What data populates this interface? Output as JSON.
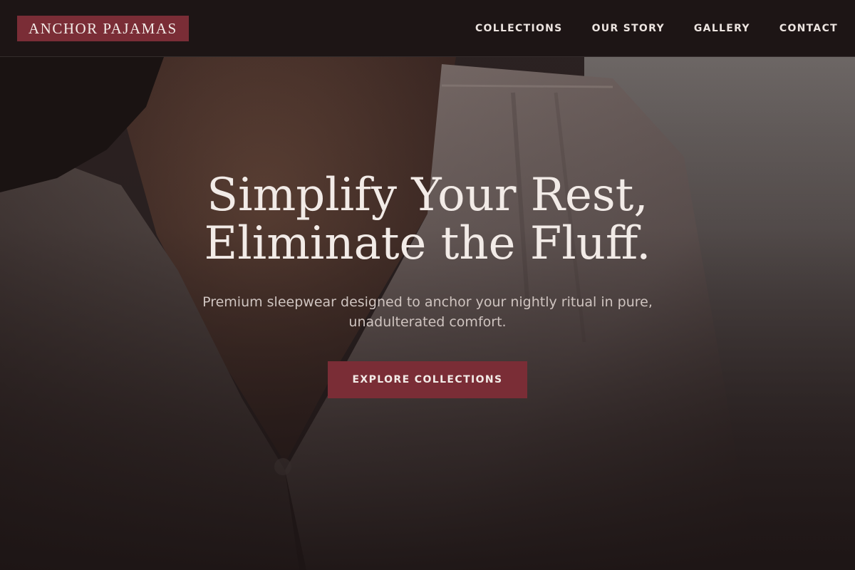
{
  "brand": {
    "name": "ANCHOR PAJAMAS",
    "accent_color": "#7a2d36",
    "header_bg": "#1c1414"
  },
  "nav": {
    "items": [
      {
        "label": "COLLECTIONS"
      },
      {
        "label": "OUR STORY"
      },
      {
        "label": "GALLERY"
      },
      {
        "label": "CONTACT"
      }
    ]
  },
  "hero": {
    "title_line1": "Simplify Your Rest,",
    "title_line2": "Eliminate the Fluff.",
    "subtitle": "Premium sleepwear designed to anchor your nightly ritual in pure, unadulterated comfort.",
    "cta_label": "EXPLORE COLLECTIONS",
    "background_image": "woman-in-satin-pajama-shirt-photo"
  }
}
